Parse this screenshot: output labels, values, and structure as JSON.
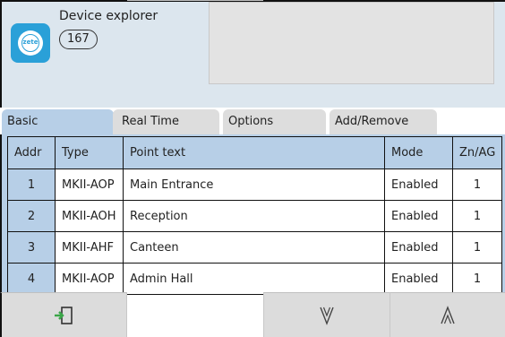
{
  "header": {
    "app_icon_text": "zete",
    "title": "Device explorer",
    "count": "167"
  },
  "tabs": [
    {
      "label": "Basic",
      "active": true
    },
    {
      "label": "Real Time",
      "active": false
    },
    {
      "label": "Options",
      "active": false
    },
    {
      "label": "Add/Remove",
      "active": false
    }
  ],
  "table": {
    "columns": [
      "Addr",
      "Type",
      "Point text",
      "Mode",
      "Zn/AG"
    ],
    "rows": [
      {
        "addr": "1",
        "type": "MKII-AOP",
        "point_text": "Main Entrance",
        "mode": "Enabled",
        "zone": "1"
      },
      {
        "addr": "2",
        "type": "MKII-AOH",
        "point_text": "Reception",
        "mode": "Enabled",
        "zone": "1"
      },
      {
        "addr": "3",
        "type": "MKII-AHF",
        "point_text": "Canteen",
        "mode": "Enabled",
        "zone": "1"
      },
      {
        "addr": "4",
        "type": "MKII-AOP",
        "point_text": "Admin Hall",
        "mode": "Enabled",
        "zone": "1"
      }
    ]
  },
  "toolbar": {
    "exit_icon": "exit-door-icon",
    "down_icon": "chevron-down-icon",
    "up_icon": "chevron-up-icon"
  },
  "colors": {
    "accent_blue": "#b7cfe7",
    "header_bg": "#dce6ee",
    "tab_inactive": "#dddddd",
    "icon_blue": "#2aa0d8",
    "exit_icon_green": "#3aa648"
  }
}
